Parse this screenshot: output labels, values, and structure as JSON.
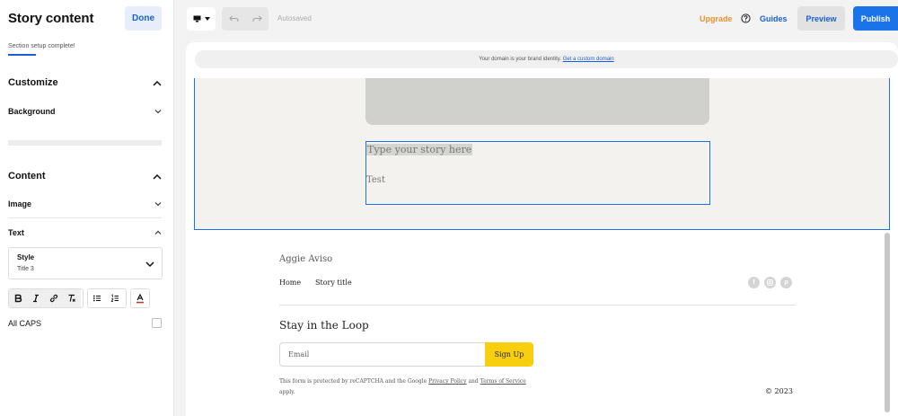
{
  "panel": {
    "title": "Story content",
    "done_label": "Done",
    "setup_status": "Section setup complete!",
    "customize": {
      "heading": "Customize",
      "background_label": "Background"
    },
    "content": {
      "heading": "Content",
      "image_label": "Image",
      "text_label": "Text",
      "style": {
        "label": "Style",
        "value": "Title 3"
      },
      "all_caps_label": "All CAPS",
      "all_caps_checked": false
    },
    "format_icons": [
      "bold-icon",
      "italic-icon",
      "link-icon",
      "clear-format-icon",
      "bullet-list-icon",
      "numbered-list-icon",
      "text-color-icon"
    ]
  },
  "toolbar": {
    "device_icon": "desktop-icon",
    "autosave_status": "Autosaved",
    "upgrade_label": "Upgrade",
    "guides_label": "Guides",
    "preview_label": "Preview",
    "publish_label": "Publish"
  },
  "canvas": {
    "domain_notice": "Your domain is your brand identity.",
    "domain_link": "Get a custom domain",
    "story": {
      "placeholder": "Type your story here",
      "text": "Test"
    },
    "footer": {
      "brand": "Aggie Aviso",
      "nav": [
        "Home",
        "Story title"
      ],
      "social_icons": [
        "facebook-icon",
        "instagram-icon",
        "pinterest-icon"
      ],
      "newsletter_title": "Stay in the Loop",
      "email_placeholder": "Email",
      "signup_label": "Sign Up",
      "legal_pre": "This form is protected by reCAPTCHA and the Google",
      "privacy_link": "Privacy Policy",
      "legal_and": "and",
      "terms_link": "Terms of Service",
      "legal_post": "apply.",
      "copyright": "© 2023"
    }
  },
  "colors": {
    "accent": "#1a73e8",
    "upgrade": "#e8912a",
    "signup": "#f8cf0e",
    "story_bg": "#f3f2ee"
  }
}
